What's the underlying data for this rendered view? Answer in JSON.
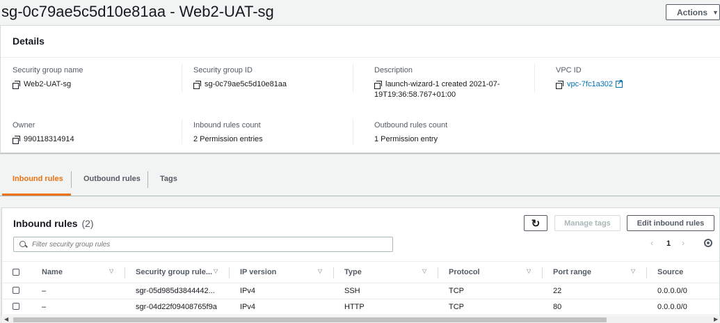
{
  "header": {
    "title": "sg-0c79ae5c5d10e81aa - Web2-UAT-sg",
    "actions_label": "Actions",
    "actions_caret": "▼"
  },
  "details": {
    "heading": "Details",
    "sg_name": {
      "label": "Security group name",
      "value": "Web2-UAT-sg"
    },
    "sg_id": {
      "label": "Security group ID",
      "value": "sg-0c79ae5c5d10e81aa"
    },
    "description": {
      "label": "Description",
      "line1": "launch-wizard-1 created 2021-07-",
      "line2": "19T19:36:58.767+01:00"
    },
    "vpc": {
      "label": "VPC ID",
      "value": "vpc-7fc1a302"
    },
    "owner": {
      "label": "Owner",
      "value": "990118314914"
    },
    "inbound_count": {
      "label": "Inbound rules count",
      "value": "2 Permission entries"
    },
    "outbound_count": {
      "label": "Outbound rules count",
      "value": "1 Permission entry"
    }
  },
  "tabs": [
    {
      "label": "Inbound rules",
      "active": true
    },
    {
      "label": "Outbound rules",
      "active": false
    },
    {
      "label": "Tags",
      "active": false
    }
  ],
  "inbound": {
    "title": "Inbound rules",
    "count": "(2)",
    "refresh_glyph": "↻",
    "manage_tags_label": "Manage tags",
    "edit_label": "Edit inbound rules",
    "search_placeholder": "Filter security group rules",
    "pager": {
      "prev": "‹",
      "page": "1",
      "next": "›"
    },
    "sort_glyph": "▽",
    "columns": [
      "Name",
      "Security group rule...",
      "IP version",
      "Type",
      "Protocol",
      "Port range",
      "Source"
    ],
    "rows": [
      {
        "name": "–",
        "rule_id": "sgr-05d985d3844442...",
        "ip_version": "IPv4",
        "type": "SSH",
        "protocol": "TCP",
        "port_range": "22",
        "source": "0.0.0.0/0"
      },
      {
        "name": "–",
        "rule_id": "sgr-04d22f09408765f9a",
        "ip_version": "IPv4",
        "type": "HTTP",
        "protocol": "TCP",
        "port_range": "80",
        "source": "0.0.0.0/0"
      }
    ]
  },
  "scrollbar": {
    "left_arrow": "◀",
    "right_arrow": "▶"
  },
  "colors": {
    "accent": "#ec7211",
    "link": "#0073bb",
    "text": "#16191f",
    "muted": "#545b64"
  }
}
